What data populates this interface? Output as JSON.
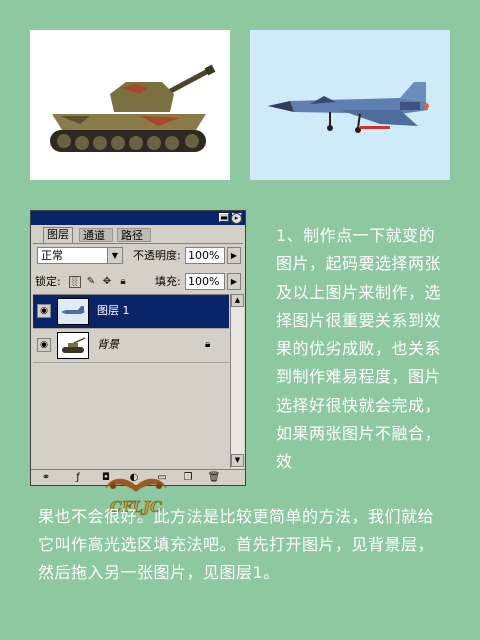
{
  "images": {
    "tank_icon": "tank-photo",
    "jet_icon": "fighter-jet-photo"
  },
  "palette": {
    "titlebar_buttons": [
      "▬",
      "✕"
    ],
    "tabs": [
      "图层",
      "通道",
      "路径"
    ],
    "menu_button": "▸",
    "blend_mode": "正常",
    "opacity_label": "不透明度:",
    "opacity_value": "100%",
    "lock_label": "锁定:",
    "fill_label": "填充:",
    "fill_value": "100%",
    "layers": [
      {
        "name": "图层 1",
        "selected": true,
        "thumb": "jet"
      },
      {
        "name": "背景",
        "selected": false,
        "thumb": "tank",
        "locked": true
      }
    ],
    "watermark_text": "CFLJC",
    "colors": {
      "titlebar": "#0a246a",
      "selected_row": "#0a246a",
      "panel": "#d4d0c8"
    }
  },
  "text": {
    "para1": "1、制作点一下就变的图片，起码要选择两张及以上图片来制作，选择图片很重要关系到效果的优劣成败，也关系到制作难易程度，图片选择好很快就会完成，如果两张图片不融合，效",
    "para2": "果也不会很好。此方法是比较更简单的方法，我们就给它叫作高光选区填充法吧。首先打开图片，见背景层，然后拖入另一张图片，见图层1。"
  },
  "colors": {
    "page_background": "#8dc8a1",
    "text": "#ffffff"
  }
}
